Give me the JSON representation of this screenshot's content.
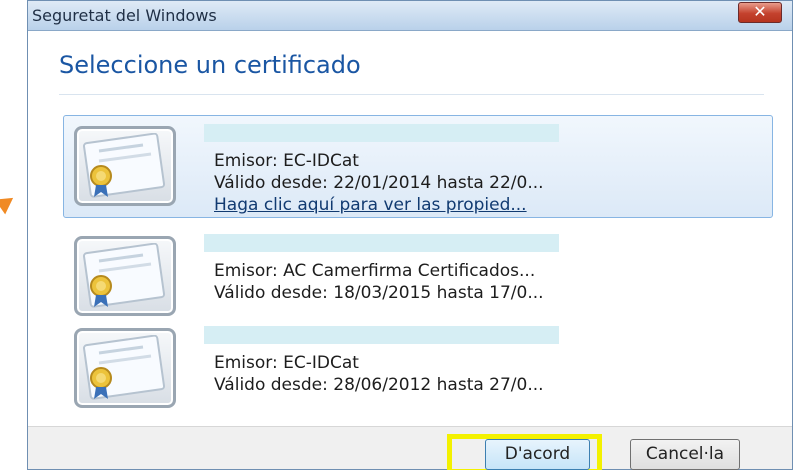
{
  "window": {
    "title": "Seguretat del Windows",
    "close_label": "✕"
  },
  "dialog": {
    "title": "Seleccione un certificado"
  },
  "certificates": [
    {
      "selected": true,
      "name_redacted": true,
      "issuer": "Emisor: EC-IDCat",
      "validity": "Válido desde: 22/01/2014 hasta 22/0...",
      "details_link": "Haga clic aquí para ver las propied..."
    },
    {
      "selected": false,
      "name_redacted": true,
      "issuer": "Emisor: AC Camerfirma Certificados...",
      "validity": "Válido desde: 18/03/2015 hasta 17/0..."
    },
    {
      "selected": false,
      "name_redacted": true,
      "issuer": "Emisor: EC-IDCat",
      "validity": "Válido desde: 28/06/2012 hasta 27/0..."
    }
  ],
  "buttons": {
    "ok": "D'acord",
    "cancel": "Cancel·la"
  },
  "icons": {
    "certificate": "certificate-icon",
    "close": "close-icon"
  },
  "colors": {
    "dialog_title": "#1a56a3",
    "selection_border": "#87b5e3",
    "ok_highlight": "#f3f100",
    "annotation_arrow": "#f08a24"
  }
}
